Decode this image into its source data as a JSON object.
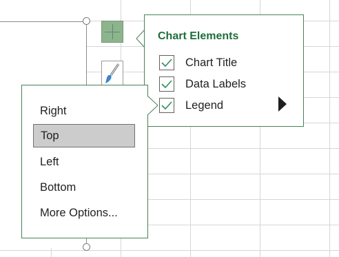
{
  "chart_elements": {
    "title": "Chart Elements",
    "items": [
      {
        "label": "Chart Title",
        "checked": true
      },
      {
        "label": "Data Labels",
        "checked": true
      },
      {
        "label": "Legend",
        "checked": true
      }
    ]
  },
  "legend_menu": {
    "items": [
      "Right",
      "Top",
      "Left",
      "Bottom",
      "More Options..."
    ],
    "selected": "Top"
  },
  "colors": {
    "accent_green": "#1e6e3b",
    "panel_border": "#4a7f57",
    "plus_button_fill": "#8db48e",
    "check_green": "#2e8b57",
    "selected_bg": "#cccccc"
  },
  "icons": {
    "plus_button": "plus-icon",
    "style_button": "brush-icon",
    "legend_expand": "triangle-right-icon"
  }
}
